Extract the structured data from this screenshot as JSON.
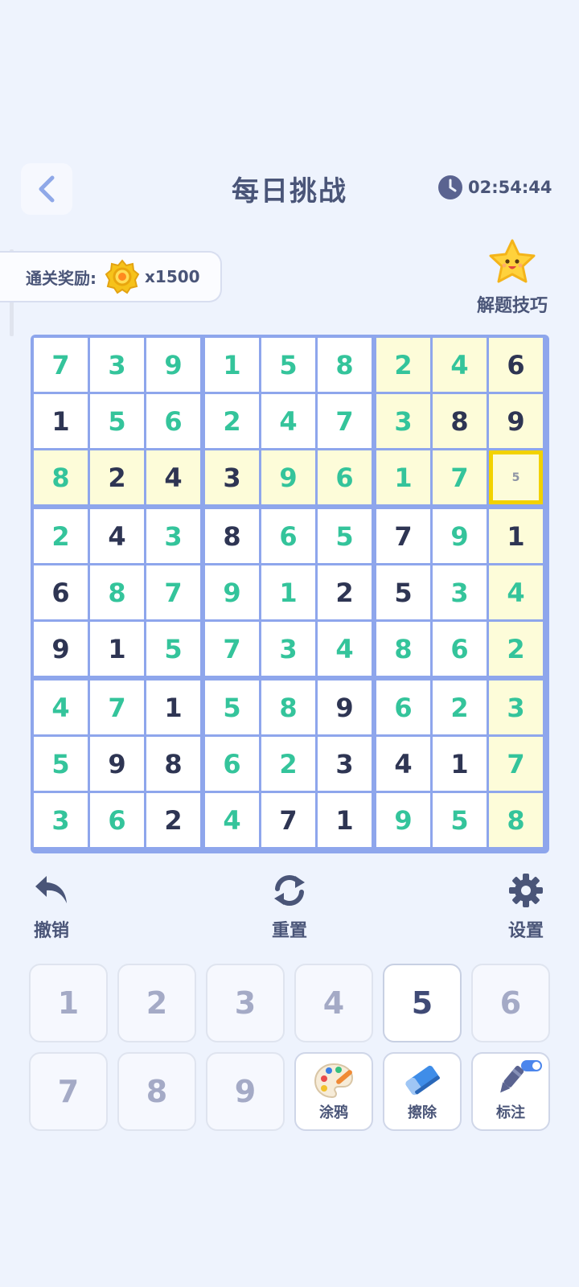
{
  "header": {
    "title": "每日挑战",
    "timer": "02:54:44"
  },
  "reward": {
    "label": "通关奖励:",
    "amount": "x1500"
  },
  "tips": {
    "label": "解题技巧"
  },
  "board": {
    "rows": [
      [
        "7",
        "3",
        "9",
        "1",
        "5",
        "8",
        "2",
        "4",
        "6"
      ],
      [
        "1",
        "5",
        "6",
        "2",
        "4",
        "7",
        "3",
        "8",
        "9"
      ],
      [
        "8",
        "2",
        "4",
        "3",
        "9",
        "6",
        "1",
        "7",
        ""
      ],
      [
        "2",
        "4",
        "3",
        "8",
        "6",
        "5",
        "7",
        "9",
        "1"
      ],
      [
        "6",
        "8",
        "7",
        "9",
        "1",
        "2",
        "5",
        "3",
        "4"
      ],
      [
        "9",
        "1",
        "5",
        "7",
        "3",
        "4",
        "8",
        "6",
        "2"
      ],
      [
        "4",
        "7",
        "1",
        "5",
        "8",
        "9",
        "6",
        "2",
        "3"
      ],
      [
        "5",
        "9",
        "8",
        "6",
        "2",
        "3",
        "4",
        "1",
        "7"
      ],
      [
        "3",
        "6",
        "2",
        "4",
        "7",
        "1",
        "9",
        "5",
        "8"
      ]
    ],
    "given": [
      [
        0,
        0,
        0,
        0,
        0,
        0,
        0,
        0,
        1
      ],
      [
        1,
        0,
        0,
        0,
        0,
        0,
        0,
        1,
        1
      ],
      [
        0,
        1,
        1,
        1,
        0,
        0,
        0,
        0,
        0
      ],
      [
        0,
        1,
        0,
        1,
        0,
        0,
        1,
        0,
        1
      ],
      [
        1,
        0,
        0,
        0,
        0,
        1,
        1,
        0,
        0
      ],
      [
        1,
        1,
        0,
        0,
        0,
        0,
        0,
        0,
        0
      ],
      [
        0,
        0,
        1,
        0,
        0,
        1,
        0,
        0,
        0
      ],
      [
        0,
        1,
        1,
        0,
        0,
        1,
        1,
        1,
        0
      ],
      [
        0,
        0,
        1,
        0,
        1,
        1,
        0,
        0,
        0
      ]
    ],
    "selected": {
      "row": 2,
      "col": 8
    },
    "selected_note": "5",
    "colors": {
      "given": "#2e3553",
      "filled": "#34c49b",
      "highlight": "#fdfcd9",
      "cell": "#ffffff",
      "line": "#8ea6ec",
      "selected_border": "#f2d200"
    }
  },
  "tools": {
    "undo": "撤销",
    "reset": "重置",
    "settings": "设置"
  },
  "keypad": {
    "numbers": [
      "1",
      "2",
      "3",
      "4",
      "5",
      "6",
      "7",
      "8",
      "9"
    ],
    "active_number": "5",
    "doodle": "涂鸦",
    "erase": "擦除",
    "mark": "标注",
    "mark_toggle_on": true
  }
}
